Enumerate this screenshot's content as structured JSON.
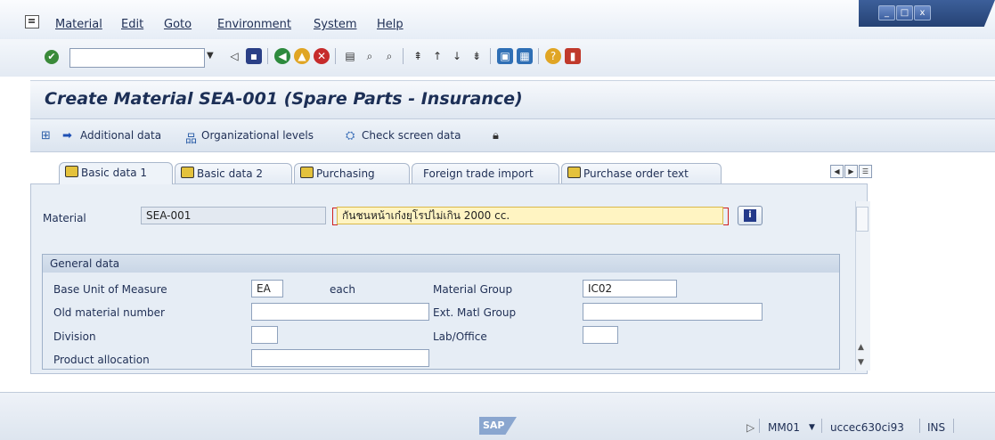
{
  "menu": {
    "items": [
      "Material",
      "Edit",
      "Goto",
      "Environment",
      "System",
      "Help"
    ]
  },
  "window_controls": {
    "minimize": "_",
    "maximize": "□",
    "close": "x"
  },
  "command_field": {
    "value": ""
  },
  "title": "Create Material SEA-001 (Spare Parts - Insurance)",
  "app_toolbar": {
    "additional_data": "Additional data",
    "organizational_levels": "Organizational levels",
    "check_screen_data": "Check screen data"
  },
  "tabs": [
    "Basic data 1",
    "Basic data 2",
    "Purchasing",
    "Foreign trade import",
    "Purchase order text"
  ],
  "active_tab": "Basic data 1",
  "material": {
    "label": "Material",
    "number": "SEA-001",
    "description": "กันชนหน้าเก๋งยุโรปไม่เกิน 2000 cc."
  },
  "general_data": {
    "title": "General data",
    "base_unit_label": "Base Unit of Measure",
    "base_unit_value": "EA",
    "base_unit_text": "each",
    "old_material_label": "Old material number",
    "old_material_value": "",
    "division_label": "Division",
    "division_value": "",
    "product_allocation_label": "Product allocation",
    "product_allocation_value": "",
    "material_group_label": "Material Group",
    "material_group_value": "IC02",
    "ext_matl_group_label": "Ext. Matl Group",
    "ext_matl_group_value": "",
    "lab_office_label": "Lab/Office",
    "lab_office_value": ""
  },
  "status": {
    "logo": "SAP",
    "transaction": "MM01",
    "server": "uccec630ci93",
    "mode": "INS"
  }
}
